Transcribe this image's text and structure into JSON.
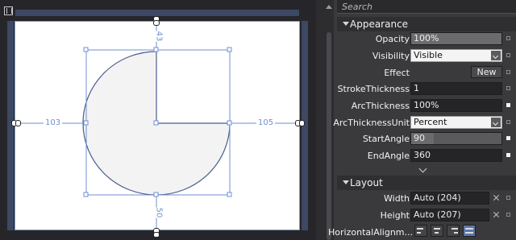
{
  "search": {
    "placeholder": "Search"
  },
  "artboard": {
    "dims": {
      "top": "43",
      "left": "103",
      "right": "105",
      "bottom": "50"
    }
  },
  "appearance": {
    "title": "Appearance",
    "opacity": {
      "label": "Opacity",
      "value": "100%"
    },
    "visibility": {
      "label": "Visibility",
      "value": "Visible"
    },
    "effect": {
      "label": "Effect",
      "button": "New"
    },
    "stroke_thickness": {
      "label": "StrokeThickness",
      "value": "1"
    },
    "arc_thickness": {
      "label": "ArcThickness",
      "value": "100%"
    },
    "arc_thickness_unit": {
      "label": "ArcThicknessUnit",
      "value": "Percent"
    },
    "start_angle": {
      "label": "StartAngle",
      "value": "90"
    },
    "end_angle": {
      "label": "EndAngle",
      "value": "360"
    }
  },
  "layout": {
    "title": "Layout",
    "width": {
      "label": "Width",
      "value": "Auto (204)"
    },
    "height": {
      "label": "Height",
      "value": "Auto (207)"
    },
    "horizontal_alignment": {
      "label": "HorizontalAlignm..."
    }
  },
  "colors": {
    "selection": "#6f8fd0",
    "arc_fill": "#f3f3f3",
    "arc_stroke": "#4a5e8e"
  }
}
